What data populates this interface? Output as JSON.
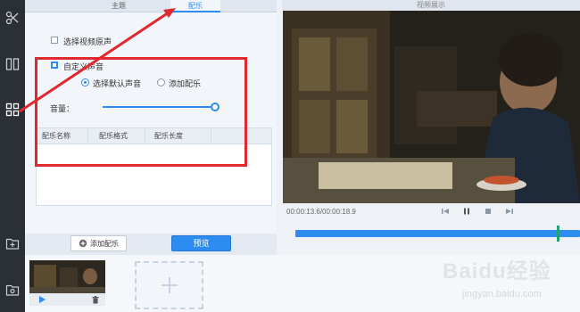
{
  "tabs": [
    {
      "label": "主题",
      "active": false
    },
    {
      "label": "配乐",
      "active": true
    }
  ],
  "options": {
    "original_sound_label": "选择视频原声",
    "custom_sound_label": "自定义声音",
    "default_sound_label": "选择默认声音",
    "add_music_radio_label": "添加配乐",
    "volume_label": "音量：",
    "volume_level": 1.0
  },
  "music_table": {
    "columns": [
      "配乐名称",
      "配乐格式",
      "配乐长度"
    ],
    "rows": []
  },
  "buttons": {
    "add_music": "添加配乐",
    "preview": "预览"
  },
  "preview": {
    "header": "视频展示",
    "timecode": "00:00:13.6/00:00:18.9",
    "progress": 0.93
  },
  "watermark": {
    "main": "Baidu经验",
    "sub": "jingyan.baidu.com"
  },
  "colors": {
    "accent": "#2d8cf0",
    "highlight": "#e0282e",
    "marker": "#1fa56f"
  }
}
